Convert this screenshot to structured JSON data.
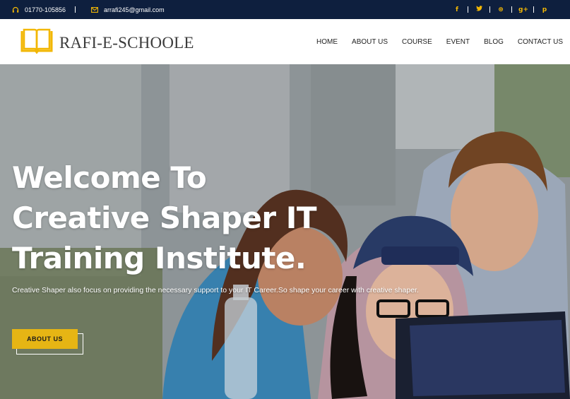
{
  "topbar": {
    "phone": "01770-105856",
    "email": "arrafi245@gmail.com",
    "social": [
      {
        "name": "facebook-icon",
        "glyph": "f"
      },
      {
        "name": "twitter-icon",
        "glyph": "t"
      },
      {
        "name": "dribbble-icon",
        "glyph": "⊛"
      },
      {
        "name": "google-plus-icon",
        "glyph": "g+"
      },
      {
        "name": "pinterest-icon",
        "glyph": "p"
      }
    ]
  },
  "header": {
    "brand": "RAFI-E-SCHOOLE",
    "nav": [
      "HOME",
      "ABOUT US",
      "COURSE",
      "EVENT",
      "BLOG",
      "CONTACT US"
    ]
  },
  "hero": {
    "title": "Welcome To Creative Shaper IT Training Institute.",
    "subtitle": "Creative Shaper also focus on providing the necessary support to your IT Career.So shape your career with creative shaper.",
    "button": "ABOUT US"
  },
  "colors": {
    "topbar_bg": "#0e1f3e",
    "accent": "#f2b705",
    "button": "#e6b514"
  }
}
